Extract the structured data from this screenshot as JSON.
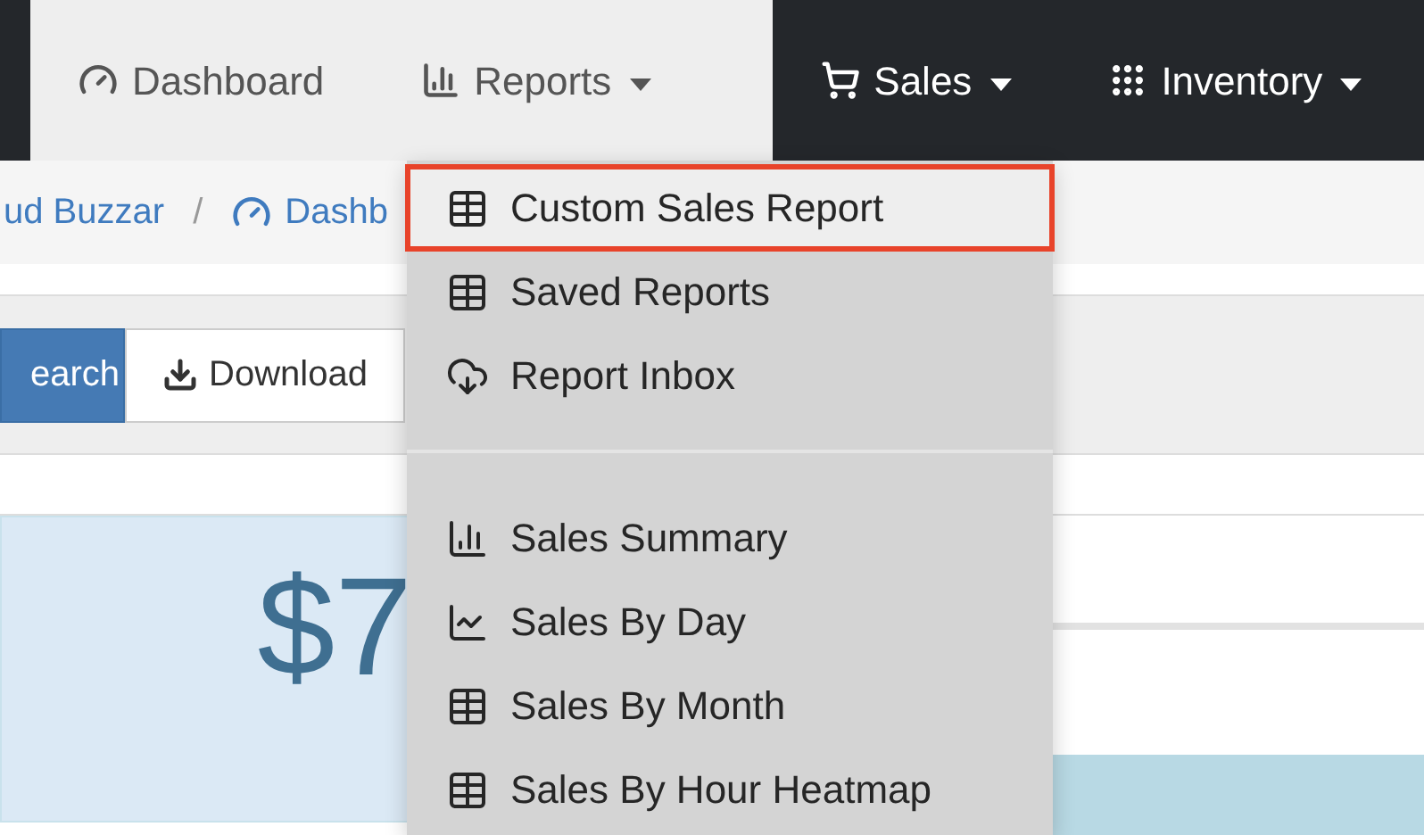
{
  "navbar": {
    "items": [
      {
        "label": "Dashboard",
        "caret": false
      },
      {
        "label": "Reports",
        "caret": true
      },
      {
        "label": "Sales",
        "caret": true
      },
      {
        "label": "Inventory",
        "caret": true
      }
    ]
  },
  "breadcrumb": [
    "ud Buzzar",
    "Dashb"
  ],
  "breadcrumb_separator": "/",
  "toolbar": {
    "buttons": [
      "earch",
      "Download"
    ]
  },
  "summary": {
    "amount": "$7"
  },
  "reports_menu": {
    "groups": [
      [
        {
          "label": "Custom Sales Report",
          "selected": true
        },
        {
          "label": "Saved Reports",
          "selected": false
        },
        {
          "label": "Report Inbox",
          "selected": false
        }
      ],
      [
        {
          "label": "Sales Summary",
          "selected": false
        },
        {
          "label": "Sales By Day",
          "selected": false
        },
        {
          "label": "Sales By Month",
          "selected": false
        },
        {
          "label": "Sales By Hour Heatmap",
          "selected": false
        }
      ]
    ]
  }
}
